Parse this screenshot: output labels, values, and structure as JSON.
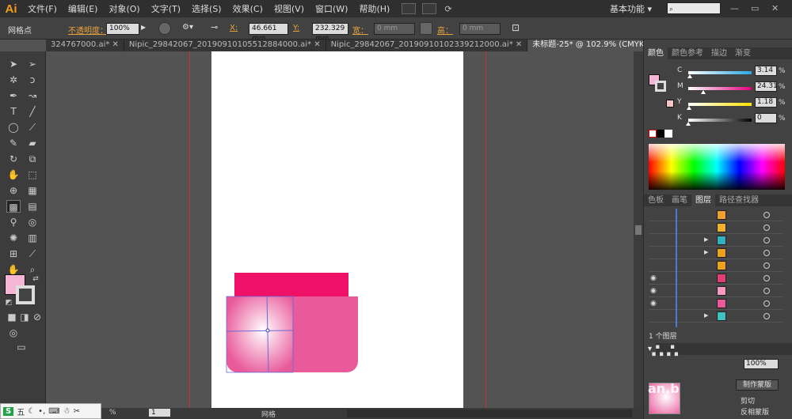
{
  "app": {
    "logo": "Ai",
    "workspace": "基本功能",
    "workspace_caret": "▾",
    "window_controls": [
      "—",
      "▭",
      "✕"
    ]
  },
  "menu": {
    "items": [
      "文件(F)",
      "编辑(E)",
      "对象(O)",
      "文字(T)",
      "选择(S)",
      "效果(C)",
      "视图(V)",
      "窗口(W)",
      "帮助(H)"
    ]
  },
  "control": {
    "tool_name": "网格点",
    "opacity_label": "不透明度：",
    "opacity_value": "100%",
    "x_label": "X:",
    "x_value": "46.661 mm",
    "y_label": "Y:",
    "y_value": "232.329 mm",
    "w_label": "宽：",
    "w_value": "0 mm",
    "h_label": "高：",
    "h_value": "0 mm"
  },
  "tabs": [
    {
      "label": "324767000.ai* ✕",
      "active": false
    },
    {
      "label": "Nipic_29842067_20190910105512884000.ai* ✕",
      "active": false
    },
    {
      "label": "Nipic_29842067_20190910102339212000.ai* ✕",
      "active": false
    },
    {
      "label": "未标题-25* @ 102.9% (CMYK/预览) ✕",
      "active": true
    }
  ],
  "color_panel": {
    "tabs": [
      "颜色",
      "颜色参考",
      "描边",
      "渐变"
    ],
    "active_tab": "颜色",
    "channels": [
      {
        "label": "C",
        "value": "3.14",
        "unit": "%",
        "color": "#4aa8e0",
        "pos": 0.03
      },
      {
        "label": "M",
        "value": "24.31",
        "unit": "%",
        "color": "#e040a0",
        "pos": 0.24
      },
      {
        "label": "Y",
        "value": "1.18",
        "unit": "%",
        "color": "#e6c81e",
        "pos": 0.01
      },
      {
        "label": "K",
        "value": "0",
        "unit": "%",
        "color": "#888888",
        "pos": 0.0
      }
    ],
    "fill_color": "#f5b6d6"
  },
  "layers_panel": {
    "tabs": [
      "色板",
      "画笔",
      "图层",
      "路径查找器"
    ],
    "active_tab": "图层",
    "footer_label": "1 个图层"
  },
  "transparency": {
    "value": "100%",
    "btn_make_mask": "制作蒙版",
    "chk_clip": "剪切",
    "chk_invert": "反相蒙版"
  },
  "status": {
    "zoom_label": "网格",
    "page": "1",
    "zoom": "%"
  },
  "ime": {
    "label": "五"
  },
  "watermark": {
    "site": "an.b"
  },
  "artwork": {
    "top_bar_color": "#ee1167",
    "body_color": "#e95a9b",
    "mesh_highlight": "#ffffff"
  }
}
